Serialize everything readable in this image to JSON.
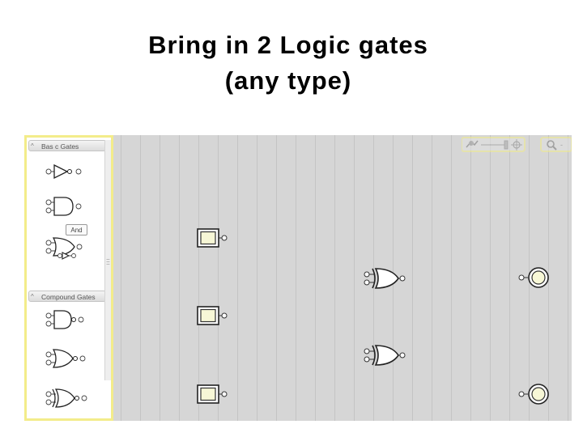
{
  "slide": {
    "title_line1": "Bring in 2 Logic gates",
    "title_line2": "(any type)"
  },
  "palette": {
    "basic_header": "Bas c Gates",
    "compound_header": "Compound Gates",
    "tooltip": "And",
    "basic_items": [
      "buffer-gate-icon",
      "and-gate-icon",
      "or-gate-icon",
      "small-buffer-icon"
    ],
    "compound_items": [
      "nand-gate-icon",
      "nor-gate-icon",
      "xnor-gate-icon"
    ]
  },
  "canvas": {
    "inputs": [
      "input-switch",
      "input-switch",
      "input-switch"
    ],
    "gates": [
      "xor-gate",
      "xor-gate"
    ],
    "outputs": [
      "output-light",
      "output-light"
    ]
  },
  "toolbar": {
    "icons": [
      "pan-icon",
      "zoom-slider",
      "zoom-center-icon",
      "search-icon"
    ]
  },
  "colors": {
    "canvas_bg": "#d6d6d6",
    "grid_line": "#c4c4c4",
    "palette_border": "#f3ec8a",
    "switch_fill": "#f7f7d6"
  }
}
